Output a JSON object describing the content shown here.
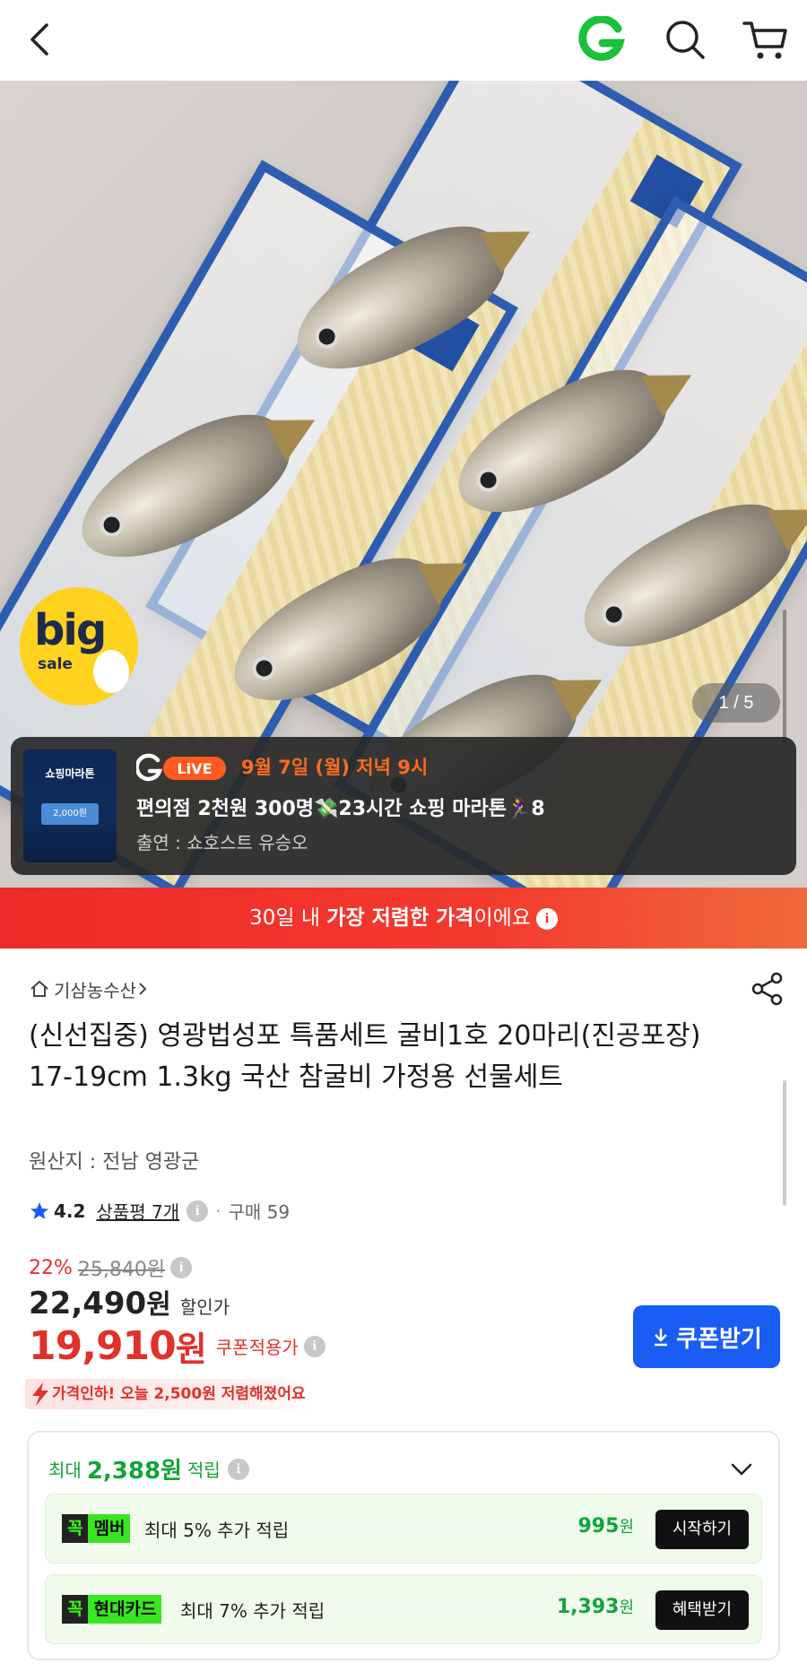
{
  "hero": {
    "badge_big": "big",
    "badge_sale": "sale",
    "pager": "1 / 5"
  },
  "live": {
    "thumb_title": "쇼핑마라톤",
    "thumb_coupon": "2,000원",
    "logo_text": "LiVE",
    "date": "9월 7일 (월) 저녁 9시",
    "title": "편의점 2천원 300명💸23시간 쇼핑 마라톤🏃‍♀️8",
    "cast": "출연 : 쇼호스트 유승오"
  },
  "banner": {
    "prefix": "30일 내 ",
    "highlight": "가장 저렴한 가격",
    "suffix": "이에요"
  },
  "product": {
    "seller": "기삼농수산",
    "title": "(신선집중) 영광법성포 특품세트 굴비1호 20마리(진공포장) 17-19cm 1.3kg 국산 참굴비 가정용 선물세트",
    "origin": "원산지 : 전남 영광군",
    "rating": "4.2",
    "reviews": "상품평 7개",
    "purchases": "구매 59"
  },
  "price": {
    "discount_pct": "22%",
    "original": "25,840원",
    "sale": "22,490",
    "sale_won": "원",
    "sale_label": "할인가",
    "coupon": "19,910",
    "coupon_won": "원",
    "coupon_label": "쿠폰적용가",
    "coupon_button": "쿠폰받기",
    "drop_notice": "가격인하! 오늘 2,500원 저렴해졌어요"
  },
  "reward": {
    "prefix": "최대",
    "amount": "2,388원",
    "suffix": "적립",
    "rows": [
      {
        "brand1": "꼭",
        "brand2": "멤버",
        "desc": "최대 5% 추가 적립",
        "points": "995",
        "unit": "원",
        "action": "시작하기"
      },
      {
        "brand1": "꼭",
        "brand2": "현대카드",
        "desc": "최대 7% 추가 적립",
        "points": "1,393",
        "unit": "원",
        "action": "혜택받기"
      }
    ]
  },
  "colors": {
    "accent_red": "#e0312c",
    "coupon_blue": "#1a5df5",
    "reward_green": "#12a53a",
    "live_orange": "#ff6a1f"
  }
}
